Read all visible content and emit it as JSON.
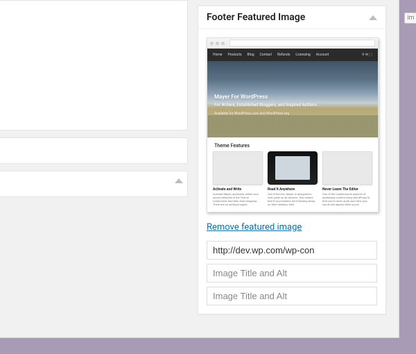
{
  "metabox": {
    "title": "Footer Featured Image",
    "remove_link": "Remove featured image",
    "url_value": "http://dev.wp.com/wp-con",
    "title_alt_placeholder": "Image Title and Alt"
  },
  "preview": {
    "nav": [
      "Home",
      "Products",
      "Blog",
      "Contact",
      "Refunds",
      "Licensing",
      "Account"
    ],
    "hero_line1": "Mayer For WordPress",
    "hero_line2": "For Writers, Established Bloggers, and Inspired Authors.",
    "hero_line3": "Available for WordPress.com and WordPress.org",
    "section_title": "Theme Features",
    "cards": [
      {
        "title": "Activate and Write",
        "body": "Activate Mayer, optionally define your social networks in the Theme Customizer, and then start blogging. There are no settings pages."
      },
      {
        "title": "Read It Anywhere",
        "body": "Out of the box, Mayer is designed to look great on all devices. This means that if your readers are following along on their desktop, their"
      },
      {
        "title": "Never Leave The Editor",
        "body": "One of the cumbersome aspects of publishing content using WordPress is that you're never quite sure how your words will appear while you're"
      }
    ]
  },
  "cropped_right_label": "im"
}
